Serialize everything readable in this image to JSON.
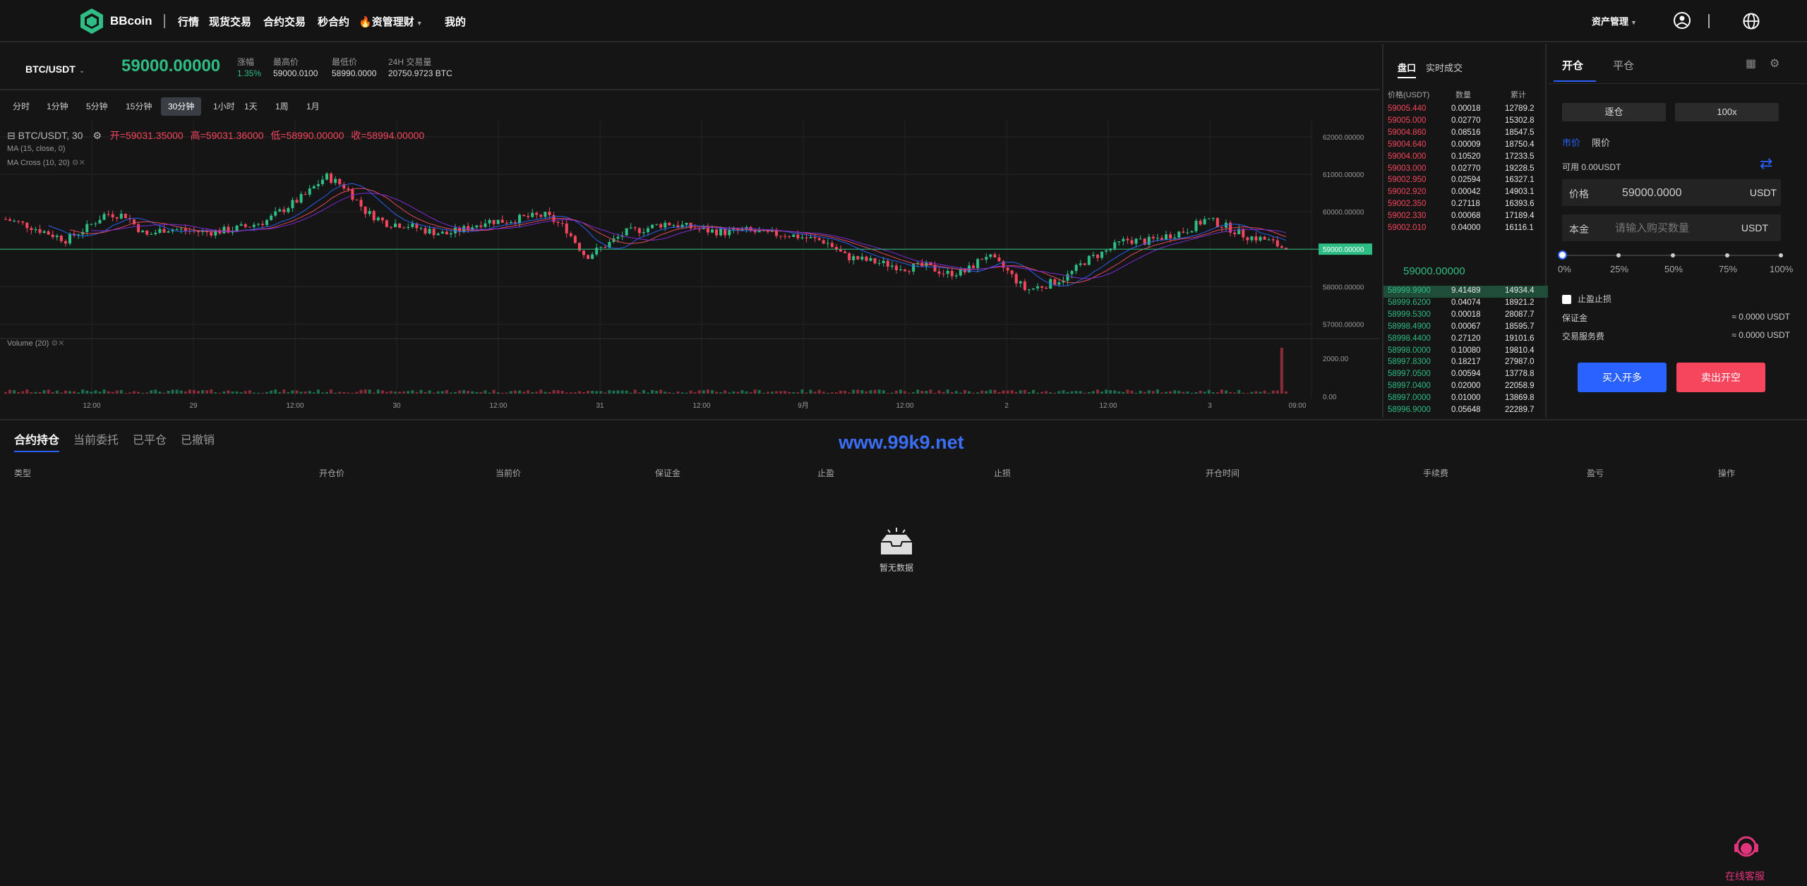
{
  "nav": {
    "brand": "BBcoin",
    "items": [
      "行情",
      "现货交易",
      "合约交易",
      "秒合约",
      "资管理财",
      "我的"
    ],
    "asset_menu": "资产管理"
  },
  "ticker": {
    "pair": "BTC/USDT",
    "price": "59000.00000",
    "change_label": "涨幅",
    "change_val": "1.35%",
    "high_label": "最高价",
    "high_val": "59000.0100",
    "low_label": "最低价",
    "low_val": "58990.0000",
    "vol_label": "24H 交易量",
    "vol_val": "20750.9723 BTC"
  },
  "timeframes": [
    "分时",
    "1分钟",
    "5分钟",
    "15分钟",
    "30分钟",
    "1小时",
    "1天",
    "1周",
    "1月"
  ],
  "timeframe_active": "30分钟",
  "chart_data": {
    "type": "candlestick",
    "title": "BTC/USDT, 30",
    "ohlc_text": {
      "open": "开=59031.35000",
      "high": "高=59031.36000",
      "low": "低=58990.00000",
      "close": "收=58994.00000"
    },
    "indicators": [
      "MA (15, close, 0)",
      "MA Cross (10, 20)"
    ],
    "volume_label": "Volume (20)",
    "y_ticks": [
      "62000.00000",
      "61000.00000",
      "60000.00000",
      "59000.00000",
      "58000.00000",
      "57000.00000"
    ],
    "volume_ticks": [
      "2000.00",
      "0.00"
    ],
    "x_ticks": [
      "12:00",
      "29",
      "12:00",
      "30",
      "12:00",
      "31",
      "12:00",
      "9月",
      "12:00",
      "2",
      "12:00",
      "3",
      "09:00"
    ],
    "last_price": "59000.00000",
    "ylim": [
      56800,
      62300
    ],
    "close_path": [
      59800,
      59650,
      59450,
      59250,
      59550,
      59950,
      59900,
      59350,
      59550,
      59500,
      59450,
      59500,
      59600,
      59750,
      60100,
      60450,
      60950,
      60650,
      60000,
      59700,
      59650,
      59500,
      59400,
      59550,
      59750,
      59750,
      59850,
      59900,
      59550,
      58800,
      59100,
      59450,
      59550,
      59700,
      59600,
      59500,
      59450,
      59500,
      59400,
      59400,
      59300,
      59200,
      58800,
      58700,
      58600,
      58500,
      58550,
      58350,
      58400,
      58850,
      58450,
      57900,
      58050,
      58250,
      58700,
      58950,
      59250,
      59200,
      59350,
      59500,
      59800,
      59600,
      59350,
      59250,
      59000
    ]
  },
  "orderbook": {
    "tabs": [
      "盘口",
      "实时成交"
    ],
    "headers": [
      "价格(USDT)",
      "数量",
      "累计"
    ],
    "asks": [
      [
        "59005.440",
        "0.00018",
        "12789.2"
      ],
      [
        "59005.000",
        "0.02770",
        "15302.8"
      ],
      [
        "59004.860",
        "0.08516",
        "18547.5"
      ],
      [
        "59004.640",
        "0.00009",
        "18750.4"
      ],
      [
        "59004.000",
        "0.10520",
        "17233.5"
      ],
      [
        "59003.000",
        "0.02770",
        "19228.5"
      ],
      [
        "59002.950",
        "0.02594",
        "16327.1"
      ],
      [
        "59002.920",
        "0.00042",
        "14903.1"
      ],
      [
        "59002.350",
        "0.27118",
        "16393.6"
      ],
      [
        "59002.330",
        "0.00068",
        "17189.4"
      ],
      [
        "59002.010",
        "0.04000",
        "16116.1"
      ]
    ],
    "mid_price": "59000.00000",
    "bids": [
      [
        "58999.9900",
        "9.41489",
        "14934.4"
      ],
      [
        "58999.6200",
        "0.04074",
        "18921.2"
      ],
      [
        "58999.5300",
        "0.00018",
        "28087.7"
      ],
      [
        "58998.4900",
        "0.00067",
        "18595.7"
      ],
      [
        "58998.4400",
        "0.27120",
        "19101.6"
      ],
      [
        "58998.0000",
        "0.10080",
        "19810.4"
      ],
      [
        "58997.8300",
        "0.18217",
        "27987.0"
      ],
      [
        "58997.0500",
        "0.00594",
        "13778.8"
      ],
      [
        "58997.0400",
        "0.02000",
        "22058.9"
      ],
      [
        "58997.0000",
        "0.01000",
        "13869.8"
      ],
      [
        "58996.9000",
        "0.05648",
        "22289.7"
      ]
    ]
  },
  "trade": {
    "tab_open": "开仓",
    "tab_close": "平仓",
    "margin_mode": "逐仓",
    "leverage": "100x",
    "order_market": "市价",
    "order_limit": "限价",
    "available": "可用 0.00USDT",
    "price_label": "价格",
    "price_value": "59000.0000",
    "unit": "USDT",
    "amount_label": "本金",
    "amount_placeholder": "请输入购买数量",
    "slider": [
      "0%",
      "25%",
      "50%",
      "75%",
      "100%"
    ],
    "tpsl_label": "止盈止损",
    "margin_label": "保证金",
    "margin_val": "≈ 0.0000 USDT",
    "fee_label": "交易服务费",
    "fee_val": "≈ 0.0000 USDT",
    "buy_btn": "买入开多",
    "sell_btn": "卖出开空"
  },
  "bottom": {
    "tabs": [
      "合约持仓",
      "当前委托",
      "已平仓",
      "已撤销"
    ],
    "columns": [
      "类型",
      "开仓价",
      "当前价",
      "保证金",
      "止盈",
      "止损",
      "开仓时间",
      "手续费",
      "盈亏",
      "操作"
    ],
    "empty": "暂无数据"
  },
  "watermark": "www.99k9.net",
  "support": "在线客服",
  "colors": {
    "up": "#2ebd85",
    "down": "#f6465d",
    "accent": "#2962ff",
    "bg": "#151515"
  }
}
